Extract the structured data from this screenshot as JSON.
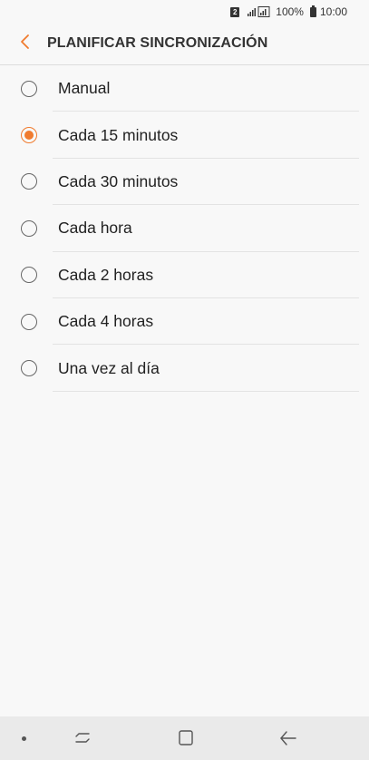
{
  "status_bar": {
    "sim": "2",
    "battery_text": "100%",
    "time": "10:00"
  },
  "header": {
    "title": "PLANIFICAR SINCRONIZACIÓN",
    "back_icon": "chevron-left-icon"
  },
  "options": [
    {
      "label": "Manual",
      "selected": false
    },
    {
      "label": "Cada 15 minutos",
      "selected": true
    },
    {
      "label": "Cada 30 minutos",
      "selected": false
    },
    {
      "label": "Cada hora",
      "selected": false
    },
    {
      "label": "Cada 2 horas",
      "selected": false
    },
    {
      "label": "Cada 4 horas",
      "selected": false
    },
    {
      "label": "Una vez al día",
      "selected": false
    }
  ],
  "colors": {
    "accent": "#f07b2e",
    "background": "#f8f8f8",
    "nav_bar": "#eaeaea"
  },
  "nav_bar": {
    "icons": [
      "dot-icon",
      "recents-icon",
      "home-icon",
      "back-arrow-icon"
    ]
  }
}
